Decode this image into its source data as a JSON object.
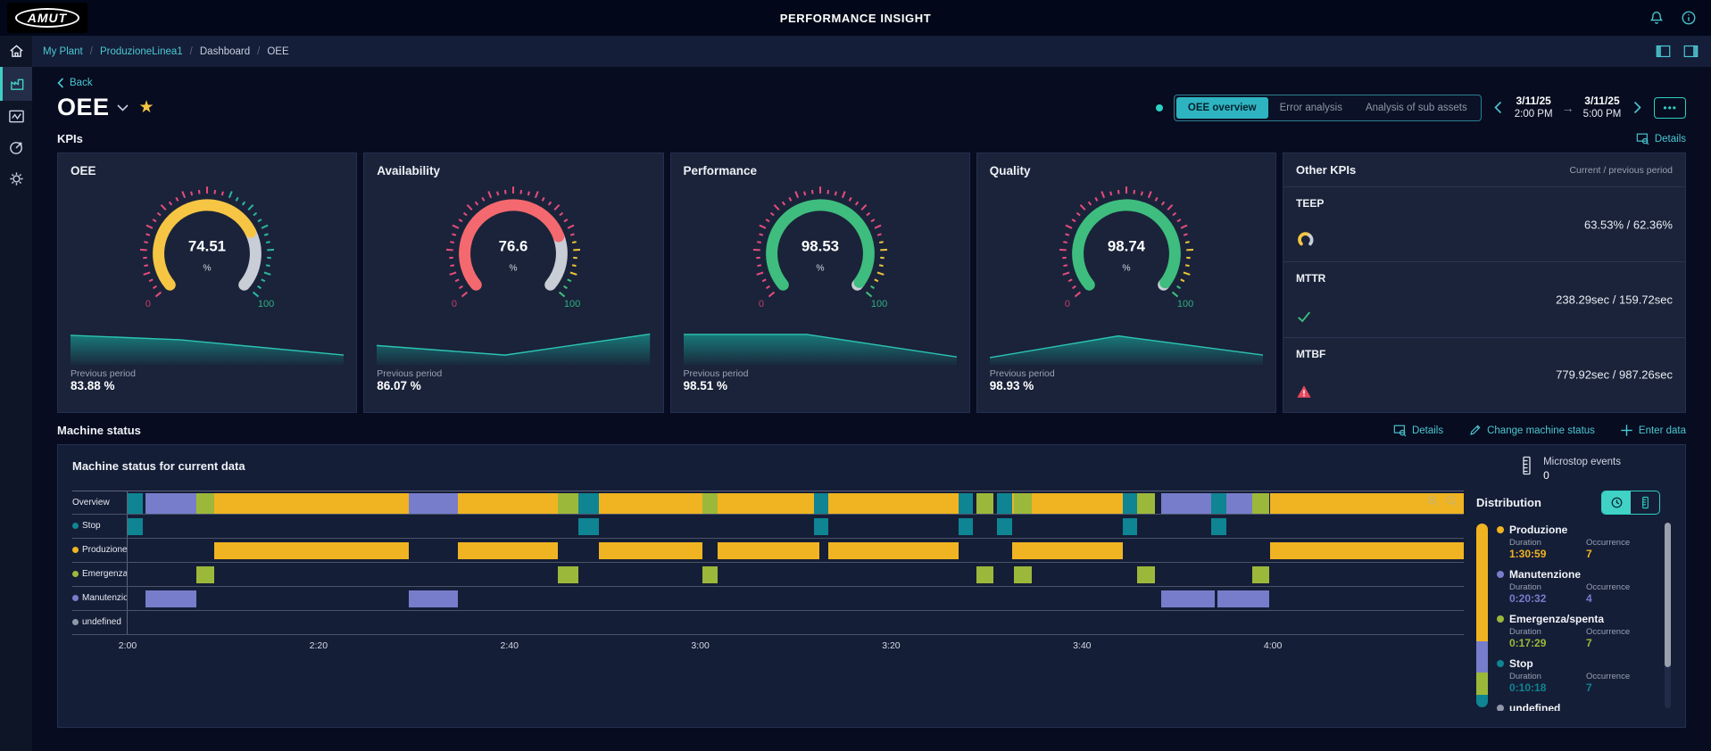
{
  "header": {
    "logo_text": "AMUT",
    "app_title": "PERFORMANCE INSIGHT"
  },
  "breadcrumb": {
    "items": [
      {
        "label": "My Plant",
        "link": true
      },
      {
        "label": "ProduzioneLinea1",
        "link": true
      },
      {
        "label": "Dashboard",
        "link": false
      },
      {
        "label": "OEE",
        "link": false
      }
    ]
  },
  "toolbar": {
    "back_label": "Back",
    "page_title": "OEE",
    "tabs": [
      {
        "label": "OEE overview",
        "active": true
      },
      {
        "label": "Error analysis",
        "active": false
      },
      {
        "label": "Analysis of sub assets",
        "active": false
      }
    ],
    "date_from": {
      "date": "3/11/25",
      "time": "2:00 PM"
    },
    "date_to": {
      "date": "3/11/25",
      "time": "5:00 PM"
    },
    "more_label": "•••"
  },
  "kpis": {
    "section_title": "KPIs",
    "details_label": "Details",
    "prev_period_label": "Previous period"
  },
  "other_kpis": {
    "title": "Other KPIs",
    "subtitle": "Current / previous period",
    "rows": [
      {
        "name": "TEEP",
        "icon": "gauge-icon",
        "value": "63.53% / 62.36%"
      },
      {
        "name": "MTTR",
        "icon": "check-icon",
        "value": "238.29sec / 159.72sec"
      },
      {
        "name": "MTBF",
        "icon": "warning-icon",
        "value": "779.92sec / 987.26sec"
      }
    ]
  },
  "machine_status": {
    "section_title": "Machine status",
    "actions": [
      {
        "label": "Details",
        "icon": "details-icon"
      },
      {
        "label": "Change machine status",
        "icon": "pencil-icon"
      },
      {
        "label": "Enter data",
        "icon": "plus-icon"
      }
    ],
    "panel_title": "Machine status for current data",
    "microstop": {
      "label": "Microstop events",
      "value": "0"
    }
  },
  "distribution": {
    "title": "Distribution",
    "duration_label": "Duration",
    "occurrence_label": "Occurrence",
    "entries": [
      {
        "name": "Produzione",
        "color": "#f0b422",
        "duration": "1:30:59",
        "occurrence": "7"
      },
      {
        "name": "Manutenzione",
        "color": "#777dcb",
        "duration": "0:20:32",
        "occurrence": "4"
      },
      {
        "name": "Emergenza/spenta",
        "color": "#9cb83a",
        "duration": "0:17:29",
        "occurrence": "7"
      },
      {
        "name": "Stop",
        "color": "#0f8492",
        "duration": "0:10:18",
        "occurrence": "7"
      },
      {
        "name": "undefined",
        "color": "#9097a8",
        "duration": "",
        "occurrence": ""
      }
    ]
  },
  "chart_data": {
    "type": "gantt",
    "gauges": [
      {
        "title": "OEE",
        "value": 74.51,
        "display": "74.51",
        "unit": "%",
        "min": "0",
        "max": "100",
        "color": "#f6c544",
        "prev": "83.88 %",
        "bands": [
          [
            0,
            56,
            "#e34b7c"
          ],
          [
            56,
            100,
            "#2ab5a0"
          ]
        ],
        "spark": [
          [
            0,
            0.82
          ],
          [
            0.4,
            0.68
          ],
          [
            1,
            0.2
          ]
        ]
      },
      {
        "title": "Availability",
        "value": 76.6,
        "display": "76.6",
        "unit": "%",
        "min": "0",
        "max": "100",
        "color": "#f4696f",
        "prev": "86.07 %",
        "bands": [
          [
            0,
            78,
            "#e34b7c"
          ],
          [
            78,
            92,
            "#e8c23a"
          ],
          [
            92,
            100,
            "#3dbd7d"
          ]
        ],
        "spark": [
          [
            0,
            0.5
          ],
          [
            0.47,
            0.2
          ],
          [
            1,
            0.86
          ]
        ]
      },
      {
        "title": "Performance",
        "value": 98.53,
        "display": "98.53",
        "unit": "%",
        "min": "0",
        "max": "100",
        "color": "#3ebd7e",
        "prev": "98.51 %",
        "bands": [
          [
            0,
            80,
            "#e34b7c"
          ],
          [
            80,
            95,
            "#e8c23a"
          ],
          [
            95,
            100,
            "#3dbd7d"
          ]
        ],
        "spark": [
          [
            0,
            0.85
          ],
          [
            0.45,
            0.85
          ],
          [
            1,
            0.14
          ]
        ]
      },
      {
        "title": "Quality",
        "value": 98.74,
        "display": "98.74",
        "unit": "%",
        "min": "0",
        "max": "100",
        "color": "#3ebd7e",
        "prev": "98.93 %",
        "bands": [
          [
            0,
            80,
            "#e34b7c"
          ],
          [
            80,
            95,
            "#e8c23a"
          ],
          [
            95,
            100,
            "#3dbd7d"
          ]
        ],
        "spark": [
          [
            0,
            0.12
          ],
          [
            0.47,
            0.8
          ],
          [
            1,
            0.2
          ]
        ]
      }
    ],
    "gantt": {
      "overview_label": "Overview",
      "window_minutes": 140,
      "tick_minutes": [
        0,
        20,
        40,
        60,
        80,
        100,
        120
      ],
      "tick_labels": [
        "2:00",
        "2:20",
        "2:40",
        "3:00",
        "3:20",
        "3:40",
        "4:00"
      ],
      "categories": [
        {
          "id": "stop",
          "label": "Stop",
          "color": "#0f8492",
          "segments": [
            [
              0,
              1.6
            ],
            [
              47.2,
              49.4
            ],
            [
              71.9,
              73.4
            ],
            [
              87.1,
              88.6
            ],
            [
              91.1,
              92.7
            ],
            [
              104.3,
              105.8
            ],
            [
              113.5,
              115.1
            ]
          ]
        },
        {
          "id": "produzione",
          "label": "Produzione",
          "color": "#f0b422",
          "segments": [
            [
              9.1,
              29.5
            ],
            [
              34.6,
              45.1
            ],
            [
              49.4,
              60.2
            ],
            [
              61.8,
              72.5
            ],
            [
              73.4,
              87.1
            ],
            [
              92.7,
              104.3
            ],
            [
              119.7,
              140
            ]
          ]
        },
        {
          "id": "emergenza",
          "label": "Emergenza/...",
          "full_label": "Emergenza/spenta",
          "color": "#9cb83a",
          "segments": [
            [
              7.2,
              9.1
            ],
            [
              45.1,
              47.2
            ],
            [
              60.2,
              61.8
            ],
            [
              88.9,
              90.7
            ],
            [
              92.9,
              94.7
            ],
            [
              105.8,
              107.6
            ],
            [
              117.8,
              119.6
            ]
          ]
        },
        {
          "id": "manutenzione",
          "label": "Manutenzione",
          "color": "#777dcb",
          "segments": [
            [
              1.9,
              7.2
            ],
            [
              29.5,
              34.6
            ],
            [
              108.3,
              113.9
            ],
            [
              114.2,
              119.6
            ]
          ]
        },
        {
          "id": "undefined",
          "label": "undefined",
          "color": "#9097a8",
          "segments": []
        }
      ]
    },
    "distribution_bar": [
      [
        "#f0b422",
        0.64
      ],
      [
        "#777dcb",
        0.17
      ],
      [
        "#9cb83a",
        0.12
      ],
      [
        "#0f8492",
        0.07
      ]
    ]
  }
}
